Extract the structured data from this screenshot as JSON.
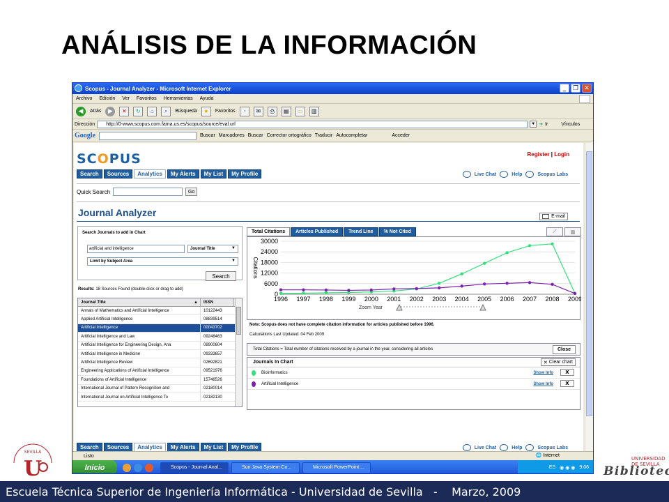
{
  "slide": {
    "title": "ANÁLISIS DE LA INFORMACIÓN",
    "footer": "Escuela Técnica Superior de Ingeniería Informática - Universidad de Sevilla   -    Marzo, 2009",
    "logo_left": "UNIVERSIDAD DE SEVILLA",
    "logo_right_small": "UNIVERSIDAD DE SEVILLA",
    "logo_right": "Biblioteca"
  },
  "browser": {
    "title": "Scopus - Journal Analyzer - Microsoft Internet Explorer",
    "menu": [
      "Archivo",
      "Edición",
      "Ver",
      "Favoritos",
      "Herramientas",
      "Ayuda"
    ],
    "toolbar": {
      "back": "Atrás",
      "search": "Búsqueda",
      "favorites": "Favoritos"
    },
    "address_label": "Dirección",
    "address": "http://0-www.scopus.com.fama.us.es/scopus/source/eval.url",
    "go": "Ir",
    "links": "Vínculos",
    "google": {
      "label": "Google",
      "search": "Buscar",
      "bookmarks": "Marcadores",
      "search2": "Buscar",
      "spell": "Corrector ortográfico",
      "translate": "Traducir",
      "autofill": "Autocompletar",
      "login": "Acceder"
    },
    "status": "Listo",
    "zone": "Internet"
  },
  "scopus": {
    "logo_a": "SC",
    "logo_b": "O",
    "logo_c": "PUS",
    "register": "Register",
    "login": "Login",
    "nav": [
      "Search",
      "Sources",
      "Analytics",
      "My Alerts",
      "My List",
      "My Profile"
    ],
    "live_chat": "Live Chat",
    "help": "Help",
    "labs": "Scopus Labs",
    "quick_search_label": "Quick Search",
    "go": "Go",
    "journal_analyzer": "Journal Analyzer",
    "email": "E-mail",
    "panel_heading": "Search Journals to add in Chart",
    "search_value": "artificial and intelligence",
    "search_type": "Journal Title",
    "limit": "Limit by Subject Area",
    "search_button": "Search",
    "results_bold": "Results:",
    "results_rest": "18 Sources Found (double-click or drag to add)",
    "table_headers": {
      "title": "Journal Title",
      "issn": "ISSN"
    },
    "journals": [
      {
        "title": "Annals of Mathematics and Artificial Intelligence",
        "issn": "10122443"
      },
      {
        "title": "Applied Artificial Intelligence",
        "issn": "08839514"
      },
      {
        "title": "Artificial Intelligence",
        "issn": "00043702"
      },
      {
        "title": "Artificial Intelligence and Law",
        "issn": "09248463"
      },
      {
        "title": "Artificial Intelligence for Engineering Design, Ana",
        "issn": "08900604"
      },
      {
        "title": "Artificial Intelligence in Medicine",
        "issn": "09333657"
      },
      {
        "title": "Artificial Intelligence Review",
        "issn": "02692821"
      },
      {
        "title": "Engineering Applications of Artificial Intelligence",
        "issn": "09521976"
      },
      {
        "title": "Foundations of Artificial Intelligence",
        "issn": "15746526"
      },
      {
        "title": "International Journal of Pattern Recognition and",
        "issn": "02180014"
      },
      {
        "title": "International Journal on Artificial Intelligence To",
        "issn": "02182130"
      }
    ],
    "chart_tabs": [
      "Total Citations",
      "Articles Published",
      "Trend Line",
      "% Not Cited"
    ],
    "zoom_label": "Zoom Year",
    "note": "Note: Scopus does not have complete citation information for articles published before 1996.",
    "calc": "Calculations Last Updated: 04 Feb 2009",
    "total_def": "Total Citations = Total number of citations received by a journal in the year, considering all articles",
    "close": "Close",
    "journals_in_chart": "Journals In Chart",
    "clear_chart": "Clear chart",
    "chart_journals": [
      {
        "name": "Bioinformatics",
        "show": "Show Info",
        "color": "#33e07a"
      },
      {
        "name": "Artificial Intelligence",
        "show": "Show Info",
        "color": "#7a1fb0"
      }
    ]
  },
  "taskbar": {
    "start": "Inicio",
    "tasks": [
      "Scopus - Journal Anal...",
      "Sun Java System Co...",
      "Microsoft PowerPoint ..."
    ],
    "lang": "ES",
    "time": "9:06"
  },
  "chart_data": {
    "type": "line",
    "x": [
      1996,
      1997,
      1998,
      1999,
      2000,
      2001,
      2002,
      2003,
      2004,
      2005,
      2006,
      2007,
      2008,
      2009
    ],
    "ylabel": "Citations",
    "yticks": [
      0,
      6000,
      12000,
      18000,
      24000,
      30000
    ],
    "ylim": [
      0,
      30000
    ],
    "series": [
      {
        "name": "Bioinformatics",
        "color": "#33e07a",
        "values": [
          400,
          600,
          800,
          1000,
          1300,
          1800,
          3000,
          6200,
          11500,
          17500,
          23500,
          27500,
          28500,
          500
        ]
      },
      {
        "name": "Artificial Intelligence",
        "color": "#7a1fb0",
        "values": [
          2500,
          2500,
          2400,
          2200,
          2400,
          3000,
          3200,
          3600,
          4600,
          5800,
          6200,
          6600,
          5600,
          400
        ]
      }
    ]
  }
}
